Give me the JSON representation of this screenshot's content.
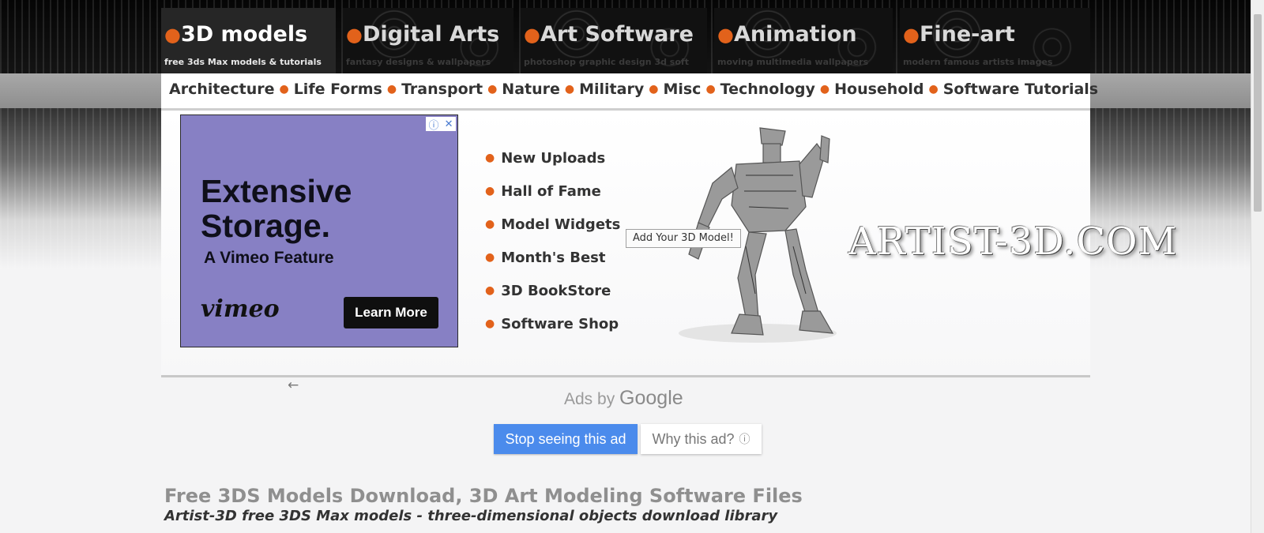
{
  "tabs": [
    {
      "title": "3D models",
      "subtitle": "free 3ds Max models & tutorials"
    },
    {
      "title": "Digital Arts",
      "subtitle": "fantasy designs & wallpapers"
    },
    {
      "title": "Art Software",
      "subtitle": "photoshop graphic design 3d soft"
    },
    {
      "title": "Animation",
      "subtitle": "moving multimedia wallpapers"
    },
    {
      "title": "Fine-art",
      "subtitle": "modern famous artists images"
    }
  ],
  "categories": [
    "Architecture",
    "Life Forms",
    "Transport",
    "Nature",
    "Military",
    "Misc",
    "Technology",
    "Household",
    "Software Tutorials"
  ],
  "ad": {
    "headline_line1": "Extensive",
    "headline_line2": "Storage.",
    "feature": "A Vimeo Feature",
    "brand": "vimeo",
    "cta": "Learn More",
    "info_icon": "ⓘ",
    "close_icon": "✕"
  },
  "quick_links": [
    "New Uploads",
    "Hall of Fame",
    "Model Widgets",
    "Month's Best",
    "3D BookStore",
    "Software Shop"
  ],
  "add_model_label": "Add Your 3D Model!",
  "logo_text": "ARTIST-3D.COM",
  "ads_panel": {
    "back_icon": "←",
    "ads_by": "Ads by",
    "google": "Google",
    "stop_label": "Stop seeing this ad",
    "why_label": "Why this ad?",
    "why_icon": "ⓘ"
  },
  "page": {
    "title": "Free 3DS Models Download, 3D Art Modeling Software Files",
    "subtitle": "Artist-3D free 3DS Max models - three-dimensional objects download library"
  },
  "colors": {
    "accent": "#e2621b",
    "ad_bg": "#8780c4",
    "stop_button": "#4b8bec"
  }
}
